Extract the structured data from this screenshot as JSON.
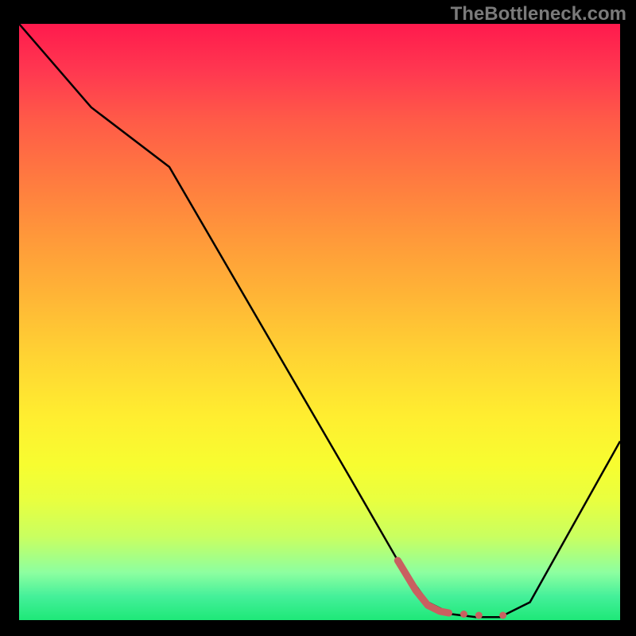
{
  "watermark": "TheBottleneck.com",
  "chart_data": {
    "type": "line",
    "title": "",
    "xlabel": "",
    "ylabel": "",
    "x_range": [
      0,
      100
    ],
    "y_range": [
      0,
      100
    ],
    "series": [
      {
        "name": "bottleneck-curve",
        "x": [
          0,
          12,
          25,
          40,
          55,
          63,
          68,
          72,
          76,
          80,
          85,
          100
        ],
        "values": [
          100,
          86,
          76,
          50,
          24,
          10,
          3,
          1,
          0.5,
          0.5,
          3,
          30
        ]
      }
    ],
    "highlight": {
      "name": "optimal-range-marker",
      "x": [
        63,
        66,
        68,
        70,
        71.5
      ],
      "values": [
        10,
        5,
        2.5,
        1.5,
        1.2
      ],
      "dots_x": [
        74,
        76.5,
        80.5
      ],
      "dots_y": [
        1.0,
        0.8,
        0.8
      ]
    },
    "gradient_stops": [
      {
        "pos": 0,
        "color": "#ff1a4d"
      },
      {
        "pos": 50,
        "color": "#ffd433"
      },
      {
        "pos": 100,
        "color": "#1ee878"
      }
    ]
  }
}
